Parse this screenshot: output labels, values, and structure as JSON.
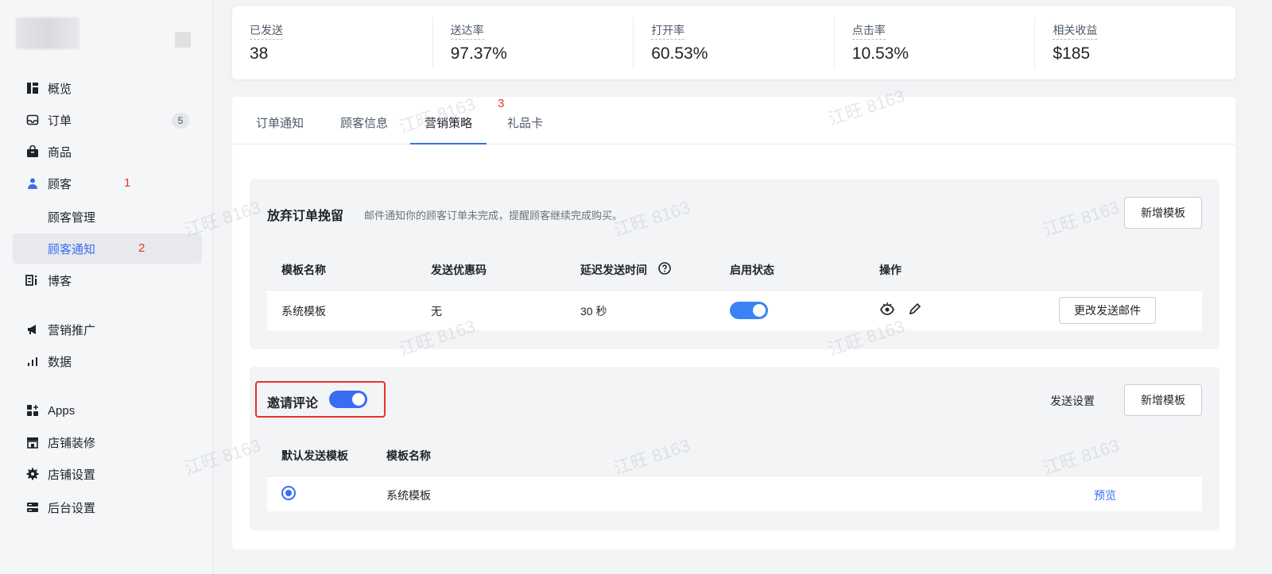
{
  "sidebar": {
    "items": [
      {
        "label": "概览",
        "icon": "dashboard-icon"
      },
      {
        "label": "订单",
        "icon": "inbox-icon",
        "badge": "5"
      },
      {
        "label": "商品",
        "icon": "bag-icon"
      },
      {
        "label": "顾客",
        "icon": "user-icon"
      },
      {
        "label": "顾客管理"
      },
      {
        "label": "顾客通知"
      },
      {
        "label": "博客",
        "icon": "blog-icon"
      },
      {
        "label": "营销推广",
        "icon": "megaphone-icon"
      },
      {
        "label": "数据",
        "icon": "bar-chart-icon"
      },
      {
        "label": "Apps",
        "icon": "apps-icon"
      },
      {
        "label": "店铺装修",
        "icon": "store-icon"
      },
      {
        "label": "店铺设置",
        "icon": "gear-icon"
      },
      {
        "label": "后台设置",
        "icon": "server-icon"
      }
    ]
  },
  "annotations": {
    "a1": "1",
    "a2": "2",
    "a3": "3"
  },
  "stats": [
    {
      "label": "已发送",
      "value": "38"
    },
    {
      "label": "送达率",
      "value": "97.37%"
    },
    {
      "label": "打开率",
      "value": "60.53%"
    },
    {
      "label": "点击率",
      "value": "10.53%"
    },
    {
      "label": "相关收益",
      "value": "$185"
    }
  ],
  "tabs": [
    "订单通知",
    "顾客信息",
    "营销策略",
    "礼品卡"
  ],
  "abandon": {
    "title": "放弃订单挽留",
    "desc": "邮件通知你的顾客订单未完成，提醒顾客继续完成购买。",
    "add_btn": "新增模板",
    "headers": [
      "模板名称",
      "发送优惠码",
      "延迟发送时间",
      "启用状态",
      "操作"
    ],
    "row": {
      "name": "系统模板",
      "coupon": "无",
      "delay": "30 秒",
      "enabled": true,
      "edit_btn": "更改发送邮件"
    }
  },
  "review": {
    "title": "邀请评论",
    "enabled": true,
    "send_settings": "发送设置",
    "add_btn": "新增模板",
    "headers": [
      "默认发送模板",
      "模板名称"
    ],
    "row": {
      "name": "系统模板",
      "preview": "预览"
    }
  },
  "watermark": "江旺 8163",
  "colors": {
    "accent": "#3a6cf4",
    "annotation": "#e8332a"
  }
}
